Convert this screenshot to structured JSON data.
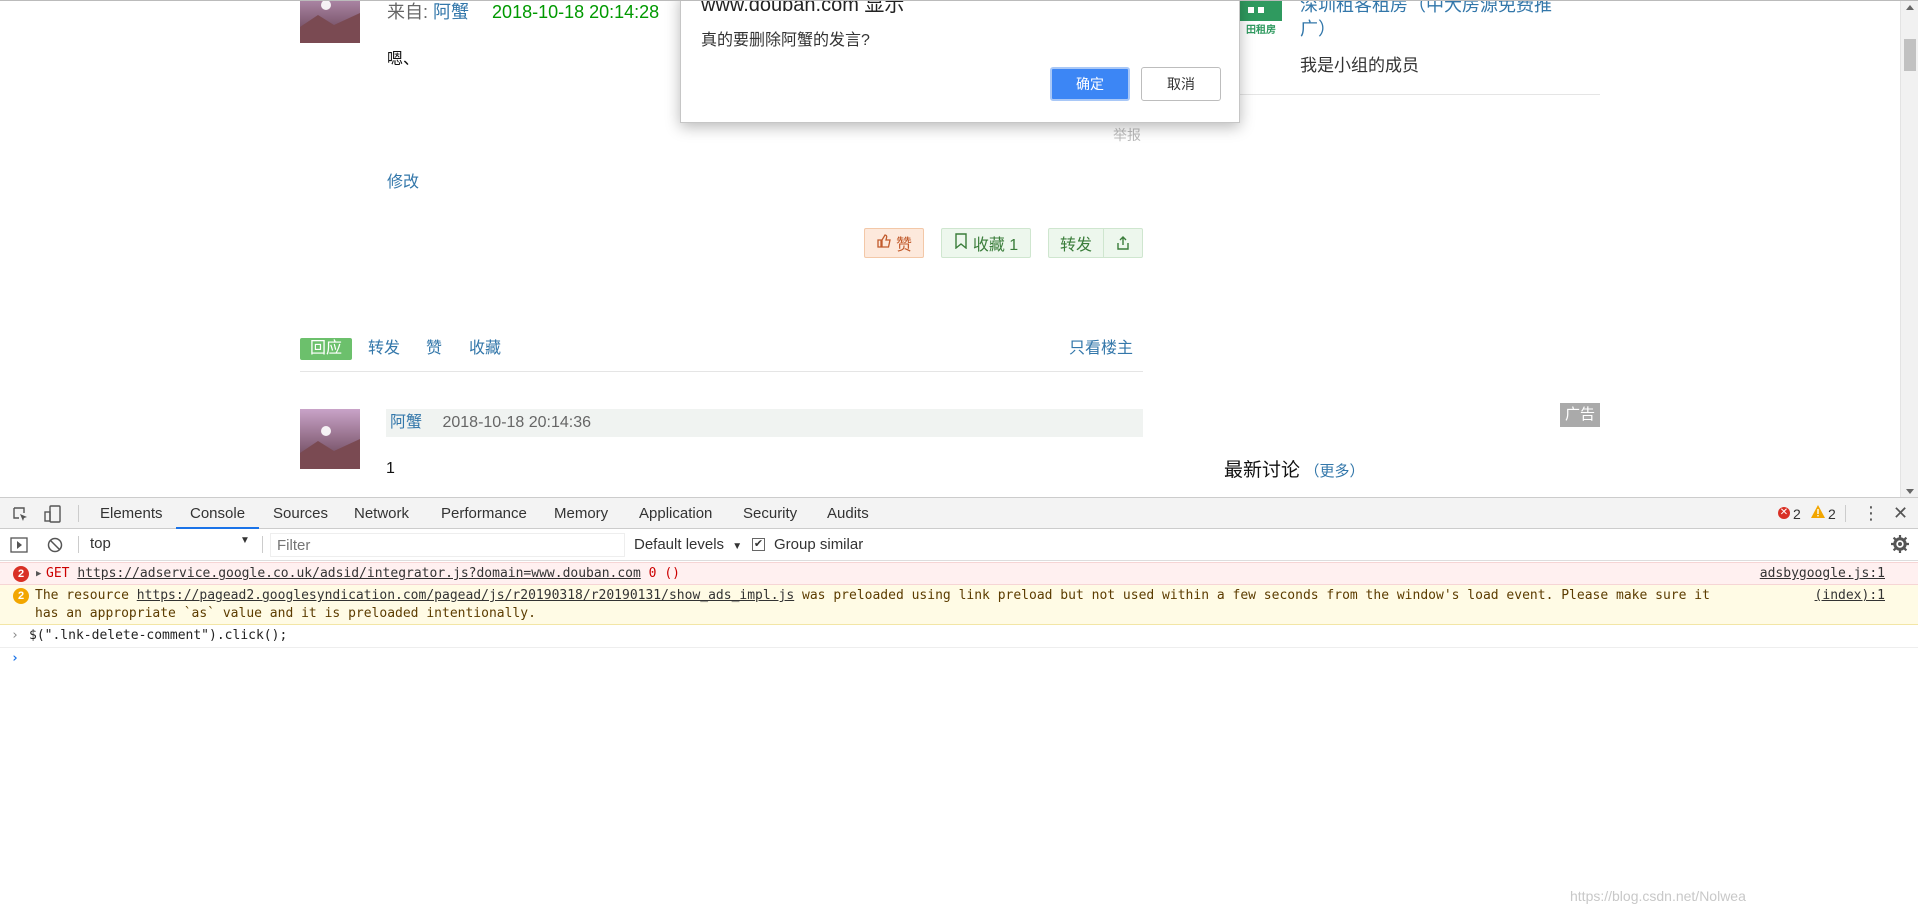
{
  "post": {
    "from_label": "来自:",
    "author": "阿蟹",
    "time": "2018-10-18 20:14:28",
    "content": "嗯、",
    "report": "举报",
    "edit": "修改",
    "like_label": "赞",
    "collect_label": "收藏 1",
    "share_label": "转发"
  },
  "tabs": {
    "reply": "回应",
    "share": "转发",
    "like": "赞",
    "collect": "收藏",
    "only_op": "只看楼主"
  },
  "reply": {
    "author": "阿蟹",
    "time": "2018-10-18 20:14:36",
    "content": "1"
  },
  "sidebar": {
    "group_name_line1": "深圳租客租房（中大房源免费推",
    "group_name_line2": "广）",
    "logo_text": "田租房",
    "membership": "我是小组的成员",
    "ad_badge": "广告",
    "latest_title": "最新讨论",
    "more_prefix": "（",
    "more_link": "更多",
    "more_suffix": "）"
  },
  "dialog": {
    "title": "www.douban.com 显示",
    "message": "真的要删除阿蟹的发言?",
    "ok": "确定",
    "cancel": "取消"
  },
  "devtools": {
    "tabs": [
      "Elements",
      "Console",
      "Sources",
      "Network",
      "Performance",
      "Memory",
      "Application",
      "Security",
      "Audits"
    ],
    "active_tab": "Console",
    "error_count": "2",
    "warning_count": "2",
    "context": "top",
    "filter_placeholder": "Filter",
    "levels": "Default levels",
    "group_similar": "Group similar",
    "group_similar_checked": true,
    "messages": {
      "error": {
        "count": "2",
        "method": "GET",
        "url": "https://adservice.google.co.uk/adsid/integrator.js?domain=www.douban.com",
        "detail": "0 ()",
        "source": "adsbygoogle.js:1"
      },
      "warning": {
        "count": "2",
        "text_before": "The resource",
        "url": "https://pagead2.googlesyndication.com/pagead/js/r20190318/r20190131/show_ads_impl.js",
        "text_after": "was preloaded using link preload but not used within a few seconds from the window's load event. Please make sure it",
        "line2": "has an appropriate `as` value and it is preloaded intentionally.",
        "source": "(index):1"
      },
      "command": "$(\".lnk-delete-comment\").click();"
    }
  },
  "watermark": "https://blog.csdn.net/Nolwea",
  "colors": {
    "accent_blue": "#3c86f5",
    "link": "#3377aa",
    "douban_green": "#6cc06c",
    "error_red": "#cc0000"
  }
}
